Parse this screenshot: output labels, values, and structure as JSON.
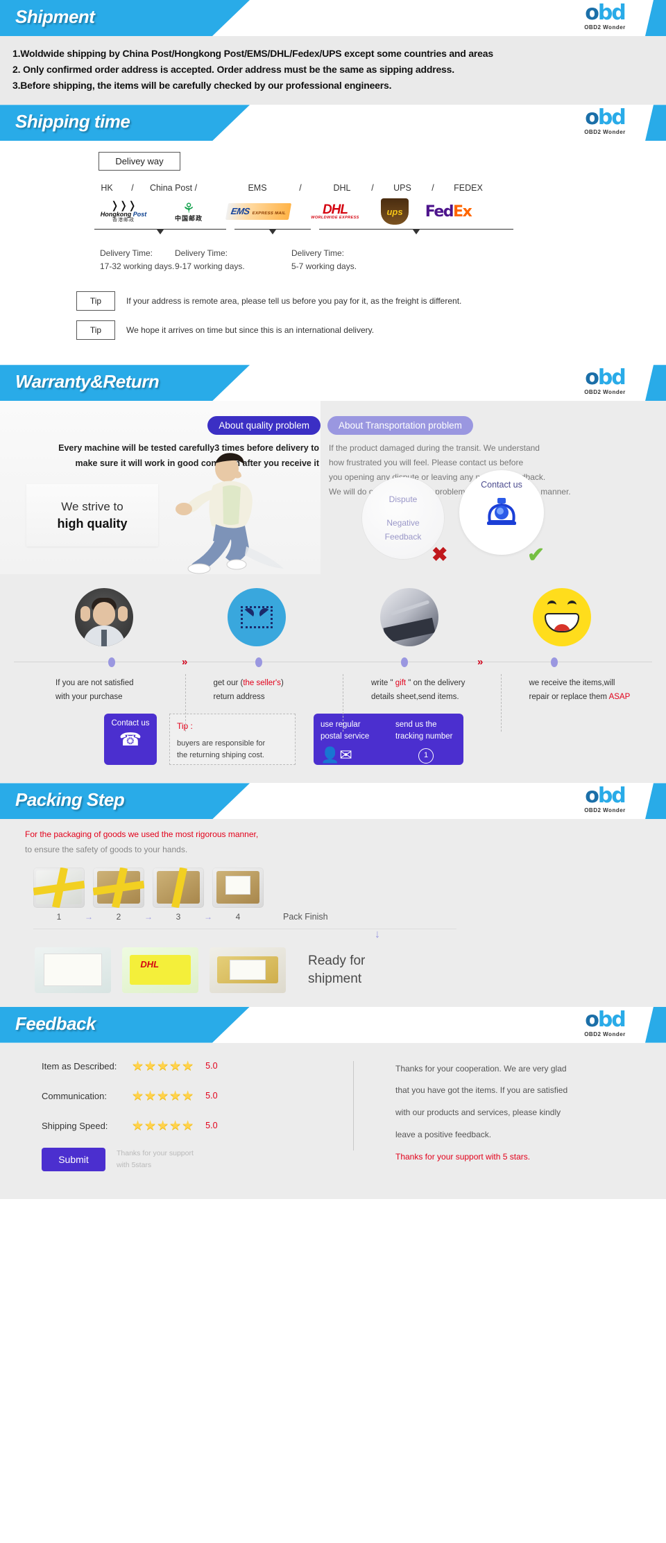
{
  "brand": {
    "mark_left": "o",
    "mark_right": "bd",
    "sub": "OBD2 Wonder"
  },
  "shipment": {
    "title": "Shipment",
    "lines": [
      "1.Woldwide shipping by China Post/Hongkong Post/EMS/DHL/Fedex/UPS  except some countries and areas",
      "2. Only confirmed order address is accepted. Order address must be the same as sipping address.",
      "3.Before shipping, the items will be carefully checked by our professional engineers."
    ]
  },
  "shipping_time": {
    "title": "Shipping time",
    "delivery_way_label": "Delivey way",
    "carriers": [
      "HK",
      "/",
      "China Post /",
      "",
      "EMS",
      "/",
      "DHL",
      "/",
      "UPS",
      "/",
      "FEDEX"
    ],
    "carrier_logos": [
      {
        "name": "hongkong-post",
        "en": "Hongkong Post",
        "cn": "香港邮政"
      },
      {
        "name": "china-post",
        "cn": "中国邮政"
      },
      {
        "name": "ems",
        "text": "EMS",
        "sub": "EMS EXPRESS MAIL SERVICE"
      },
      {
        "name": "dhl",
        "text": "DHL",
        "sub": "WORLDWIDE EXPRESS"
      },
      {
        "name": "ups",
        "text": "ups"
      },
      {
        "name": "fedex",
        "fed": "Fed",
        "ex": "Ex"
      }
    ],
    "delivery_times": [
      {
        "label": "Delivery Time:",
        "days": "17-32  working days."
      },
      {
        "label": "Delivery Time:",
        "days": "9-17  working days."
      },
      {
        "label": "Delivery Time:",
        "days": "5-7 working days."
      }
    ],
    "tips": [
      {
        "badge": "Tip",
        "text": "If your address is remote area, please tell us before you pay for it, as the freight is different."
      },
      {
        "badge": "Tip",
        "text": "We hope it arrives on time but since this is an international delivery."
      }
    ]
  },
  "warranty": {
    "title": "Warranty&Return",
    "quality_pill": "About quality problem",
    "quality_text": "Every machine will be tested carefully3 times before delivery to make sure it will work in good condition after you receive it",
    "transport_pill": "About Transportation problem",
    "transport_lines": [
      "If the product damaged during the transit. We understand",
      "how frustrated you will feel. Please contact us before",
      "you opening any dispute or leaving any negative feedback.",
      "We will do our best to fix the problem with good business manner."
    ],
    "strive_line1": "We strive to",
    "strive_line2": "high quality",
    "dispute_label": "Dispute",
    "negative_label_1": "Negative",
    "negative_label_2": "Feedback",
    "contact_label": "Contact us",
    "steps": [
      {
        "icon": "stressed-man-icon",
        "line1": "If you are not satisfied",
        "line2": "with your purchase"
      },
      {
        "icon": "envelope-icon",
        "line1_pre": "get our (",
        "line1_red": "the seller's",
        "line1_post": ")",
        "line2": "return address"
      },
      {
        "icon": "notebook-pen-icon",
        "line1_pre": "write \" ",
        "line1_red": "gift",
        "line1_post": " \" on the delivery",
        "line2": "details sheet,send items."
      },
      {
        "icon": "smiley-icon",
        "line1": "we receive the items,will",
        "line2_pre": "repair or replace them ",
        "line2_red": "ASAP"
      }
    ],
    "contact_card": {
      "label": "Contact us",
      "icon": "telephone-icon"
    },
    "tip_card": {
      "label": "Tip :",
      "text_line1": "buyers are responsible for",
      "text_line2": "the returning shiping cost."
    },
    "postal_card": {
      "left_line1": "use regular",
      "left_line2": "postal service",
      "right_line1": "send us the",
      "right_line2": "tracking number",
      "badge": "1"
    }
  },
  "packing": {
    "title": "Packing Step",
    "note_line1": "For the packaging of goods we used the most rigorous manner,",
    "note_line2": "to ensure the safety of goods to your hands.",
    "step_numbers": [
      "1",
      "2",
      "3",
      "4"
    ],
    "arrow": "→",
    "pack_finish": "Pack Finish",
    "down_arrow": "↓",
    "ready_line1": "Ready for",
    "ready_line2": "shipment"
  },
  "feedback": {
    "title": "Feedback",
    "rows": [
      {
        "label": "Item as Described:",
        "stars": "★★★★★",
        "score": "5.0"
      },
      {
        "label": "Communication:",
        "stars": "★★★★★",
        "score": "5.0"
      },
      {
        "label": "Shipping Speed:",
        "stars": "★★★★★",
        "score": "5.0"
      }
    ],
    "submit_label": "Submit",
    "submit_note_1": "Thanks for your support",
    "submit_note_2": "with 5stars",
    "message_lines": [
      "Thanks for your cooperation. We are very glad",
      "that you have got the items. If you are satisfied",
      "with our products and services, please kindly",
      "leave a positive feedback."
    ],
    "message_red": "Thanks for your support with 5 stars."
  },
  "colors": {
    "banner_blue": "#29abe8",
    "purple": "#4b2fcf",
    "red": "#e2001a",
    "star": "#ffd24d"
  }
}
